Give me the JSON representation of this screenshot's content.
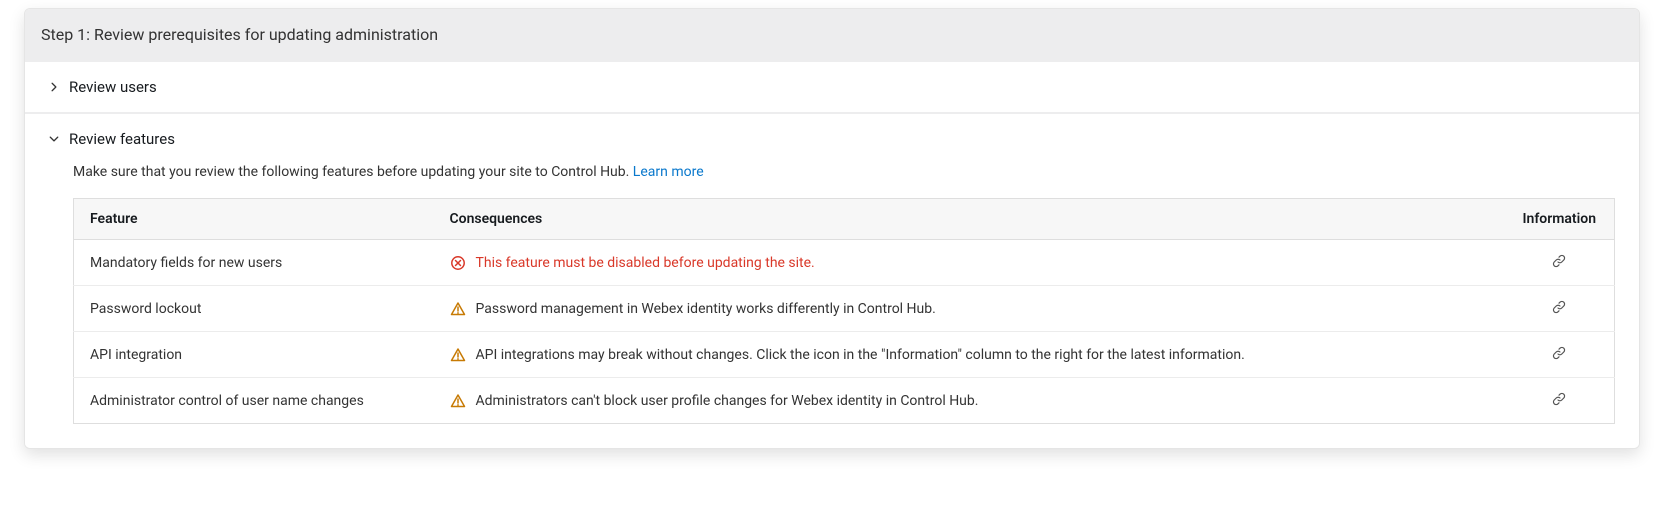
{
  "step": {
    "title": "Step 1: Review prerequisites for updating administration"
  },
  "sections": {
    "reviewUsers": {
      "title": "Review users",
      "expanded": false
    },
    "reviewFeatures": {
      "title": "Review features",
      "expanded": true,
      "intro": "Make sure that you review the following features before updating your site to Control Hub. ",
      "learnMore": "Learn more",
      "table": {
        "headers": {
          "feature": "Feature",
          "consequences": "Consequences",
          "information": "Information"
        },
        "rows": [
          {
            "feature": "Mandatory fields for new users",
            "level": "error",
            "consequence": "This feature must be disabled before updating the site."
          },
          {
            "feature": "Password lockout",
            "level": "warn",
            "consequence": "Password management in Webex identity works differently in Control Hub."
          },
          {
            "feature": "API integration",
            "level": "warn",
            "consequence": "API integrations may break without changes. Click the icon in the \"Information\" column to the right for the latest information."
          },
          {
            "feature": "Administrator control of user name changes",
            "level": "warn",
            "consequence": "Administrators can't block user profile changes for Webex identity in Control Hub."
          }
        ]
      }
    }
  }
}
